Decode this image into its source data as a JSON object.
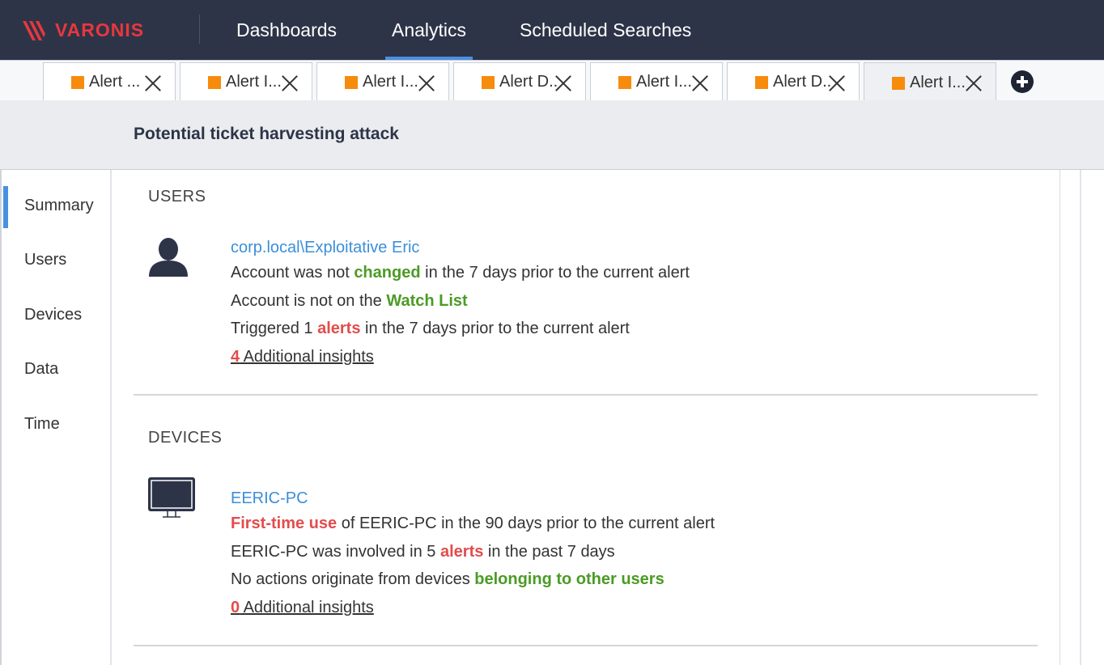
{
  "app": {
    "brand": "VARONIS",
    "brand_color": "#e8373e",
    "accent_color": "#4a90e2"
  },
  "nav": {
    "items": [
      {
        "label": "Dashboards",
        "active": false
      },
      {
        "label": "Analytics",
        "active": true
      },
      {
        "label": "Scheduled Searches",
        "active": false
      }
    ]
  },
  "tabs": [
    {
      "label": "Alert ...",
      "active": false
    },
    {
      "label": "Alert I...",
      "active": false
    },
    {
      "label": "Alert I...",
      "active": false
    },
    {
      "label": "Alert D...",
      "active": false
    },
    {
      "label": "Alert I...",
      "active": false
    },
    {
      "label": "Alert D...",
      "active": false
    },
    {
      "label": "Alert I...",
      "active": true
    }
  ],
  "alert": {
    "title": "Potential ticket harvesting attack"
  },
  "sidenav": {
    "items": [
      "Summary",
      "Users",
      "Devices",
      "Data",
      "Time"
    ],
    "active": "Summary"
  },
  "users_section": {
    "title": "USERS",
    "name": "corp.local\\Exploitative Eric",
    "line1": {
      "pre": "Account was not ",
      "hl": "changed",
      "post": " in the 7 days prior to the current alert"
    },
    "line2": {
      "pre": "Account is not on the ",
      "hl": "Watch List",
      "post": ""
    },
    "line3": {
      "pre": "Triggered 1 ",
      "hl": "alerts",
      "post": " in the 7 days prior to the current alert"
    },
    "insights": {
      "count": "4",
      "label": " Additional insights"
    }
  },
  "devices_section": {
    "title": "DEVICES",
    "name": "EERIC-PC",
    "line1": {
      "pre": "",
      "hl": "First-time use",
      "post": " of EERIC-PC in the 90 days prior to the current alert"
    },
    "line2": {
      "pre": "EERIC-PC was involved in 5 ",
      "hl": "alerts",
      "post": " in the past 7 days"
    },
    "line3": {
      "pre": "No actions originate from devices ",
      "hl": "belonging to other users",
      "post": ""
    },
    "insights": {
      "count": "0",
      "label": " Additional insights"
    }
  }
}
